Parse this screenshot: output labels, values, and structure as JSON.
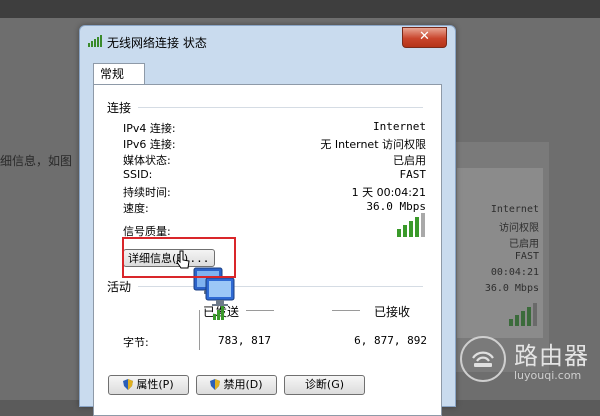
{
  "background": {
    "side_text": "细信息，如图",
    "window_lines": [
      "Internet",
      "访问权限",
      "已启用",
      "FAST",
      "00:04:21",
      "36.0 Mbps"
    ]
  },
  "watermark": {
    "main": "路由器",
    "sub": "luyouqi.com"
  },
  "dialog": {
    "title": "无线网络连接 状态",
    "close_label": "✕",
    "tab_label": "常规",
    "connection": {
      "section_label": "连接",
      "rows": [
        {
          "label": "IPv4 连接:",
          "value": "Internet"
        },
        {
          "label": "IPv6 连接:",
          "value": "无 Internet 访问权限"
        },
        {
          "label": "媒体状态:",
          "value": "已启用"
        },
        {
          "label": "SSID:",
          "value": "FAST"
        },
        {
          "label": "持续时间:",
          "value": "1 天 00:04:21"
        },
        {
          "label": "速度:",
          "value": "36.0 Mbps"
        }
      ],
      "signal_label": "信号质量:",
      "details_button": "详细信息(",
      "details_accel": "E",
      "details_suffix": ")..."
    },
    "activity": {
      "section_label": "活动",
      "sent_label": "已发送",
      "received_label": "已接收",
      "bytes_label": "字节:",
      "sent_bytes": "783, 817",
      "received_bytes": "6, 877, 892"
    },
    "buttons": {
      "properties": "属性(P)",
      "disable": "禁用(D)",
      "diagnose": "诊断(G)"
    }
  }
}
